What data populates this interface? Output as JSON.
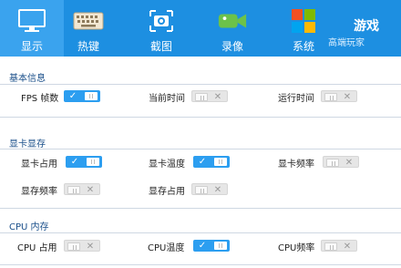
{
  "tabs": [
    {
      "label": "显示",
      "icon": "monitor-icon",
      "active": true
    },
    {
      "label": "热键",
      "icon": "keyboard-icon",
      "active": false
    },
    {
      "label": "截图",
      "icon": "camera-icon",
      "active": false
    },
    {
      "label": "录像",
      "icon": "video-camera-icon",
      "active": false
    },
    {
      "label": "系统",
      "icon": "windows-logo-icon",
      "active": false
    }
  ],
  "brand": {
    "title": "游戏",
    "subtitle": "高端玩家"
  },
  "sections": [
    {
      "title": "基本信息",
      "items": [
        {
          "label": "FPS 帧数",
          "on": true
        },
        {
          "label": "当前时间",
          "on": false
        },
        {
          "label": "运行时间",
          "on": false
        }
      ]
    },
    {
      "title": "显卡显存",
      "items": [
        {
          "label": "显卡占用",
          "on": true
        },
        {
          "label": "显卡温度",
          "on": true
        },
        {
          "label": "显卡频率",
          "on": false
        },
        {
          "label": "显存频率",
          "on": false
        },
        {
          "label": "显存占用",
          "on": false
        }
      ]
    },
    {
      "title": "CPU 内存",
      "items": [
        {
          "label": "CPU 占用",
          "on": false
        },
        {
          "label": "CPU温度",
          "on": true
        },
        {
          "label": "CPU频率",
          "on": false
        }
      ]
    }
  ],
  "toggle_marks": {
    "on": "✓",
    "off": "✕"
  },
  "colors": {
    "accent": "#1d8fe1",
    "toggle_on": "#2c9ef0",
    "section_title": "#1a4f8a"
  }
}
